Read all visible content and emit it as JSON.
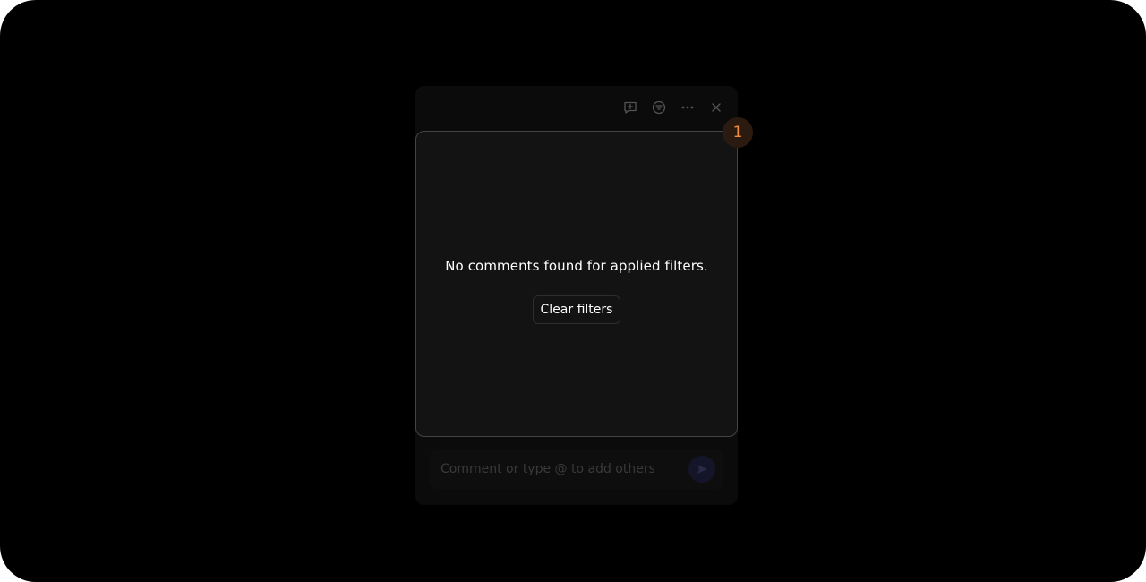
{
  "toolbar": {
    "icons": [
      "add-comment-icon",
      "filter-icon",
      "more-icon",
      "close-icon"
    ]
  },
  "empty_state": {
    "message": "No comments found for applied filters.",
    "clear_label": "Clear filters"
  },
  "badge": {
    "count": "1"
  },
  "composer": {
    "placeholder": "Comment or type @ to add others"
  },
  "colors": {
    "background": "#000000",
    "panel": "#0b0b0b",
    "card": "#131313",
    "card_border": "#444444",
    "badge_text": "#f08a3c",
    "send_button": "#15152a"
  }
}
